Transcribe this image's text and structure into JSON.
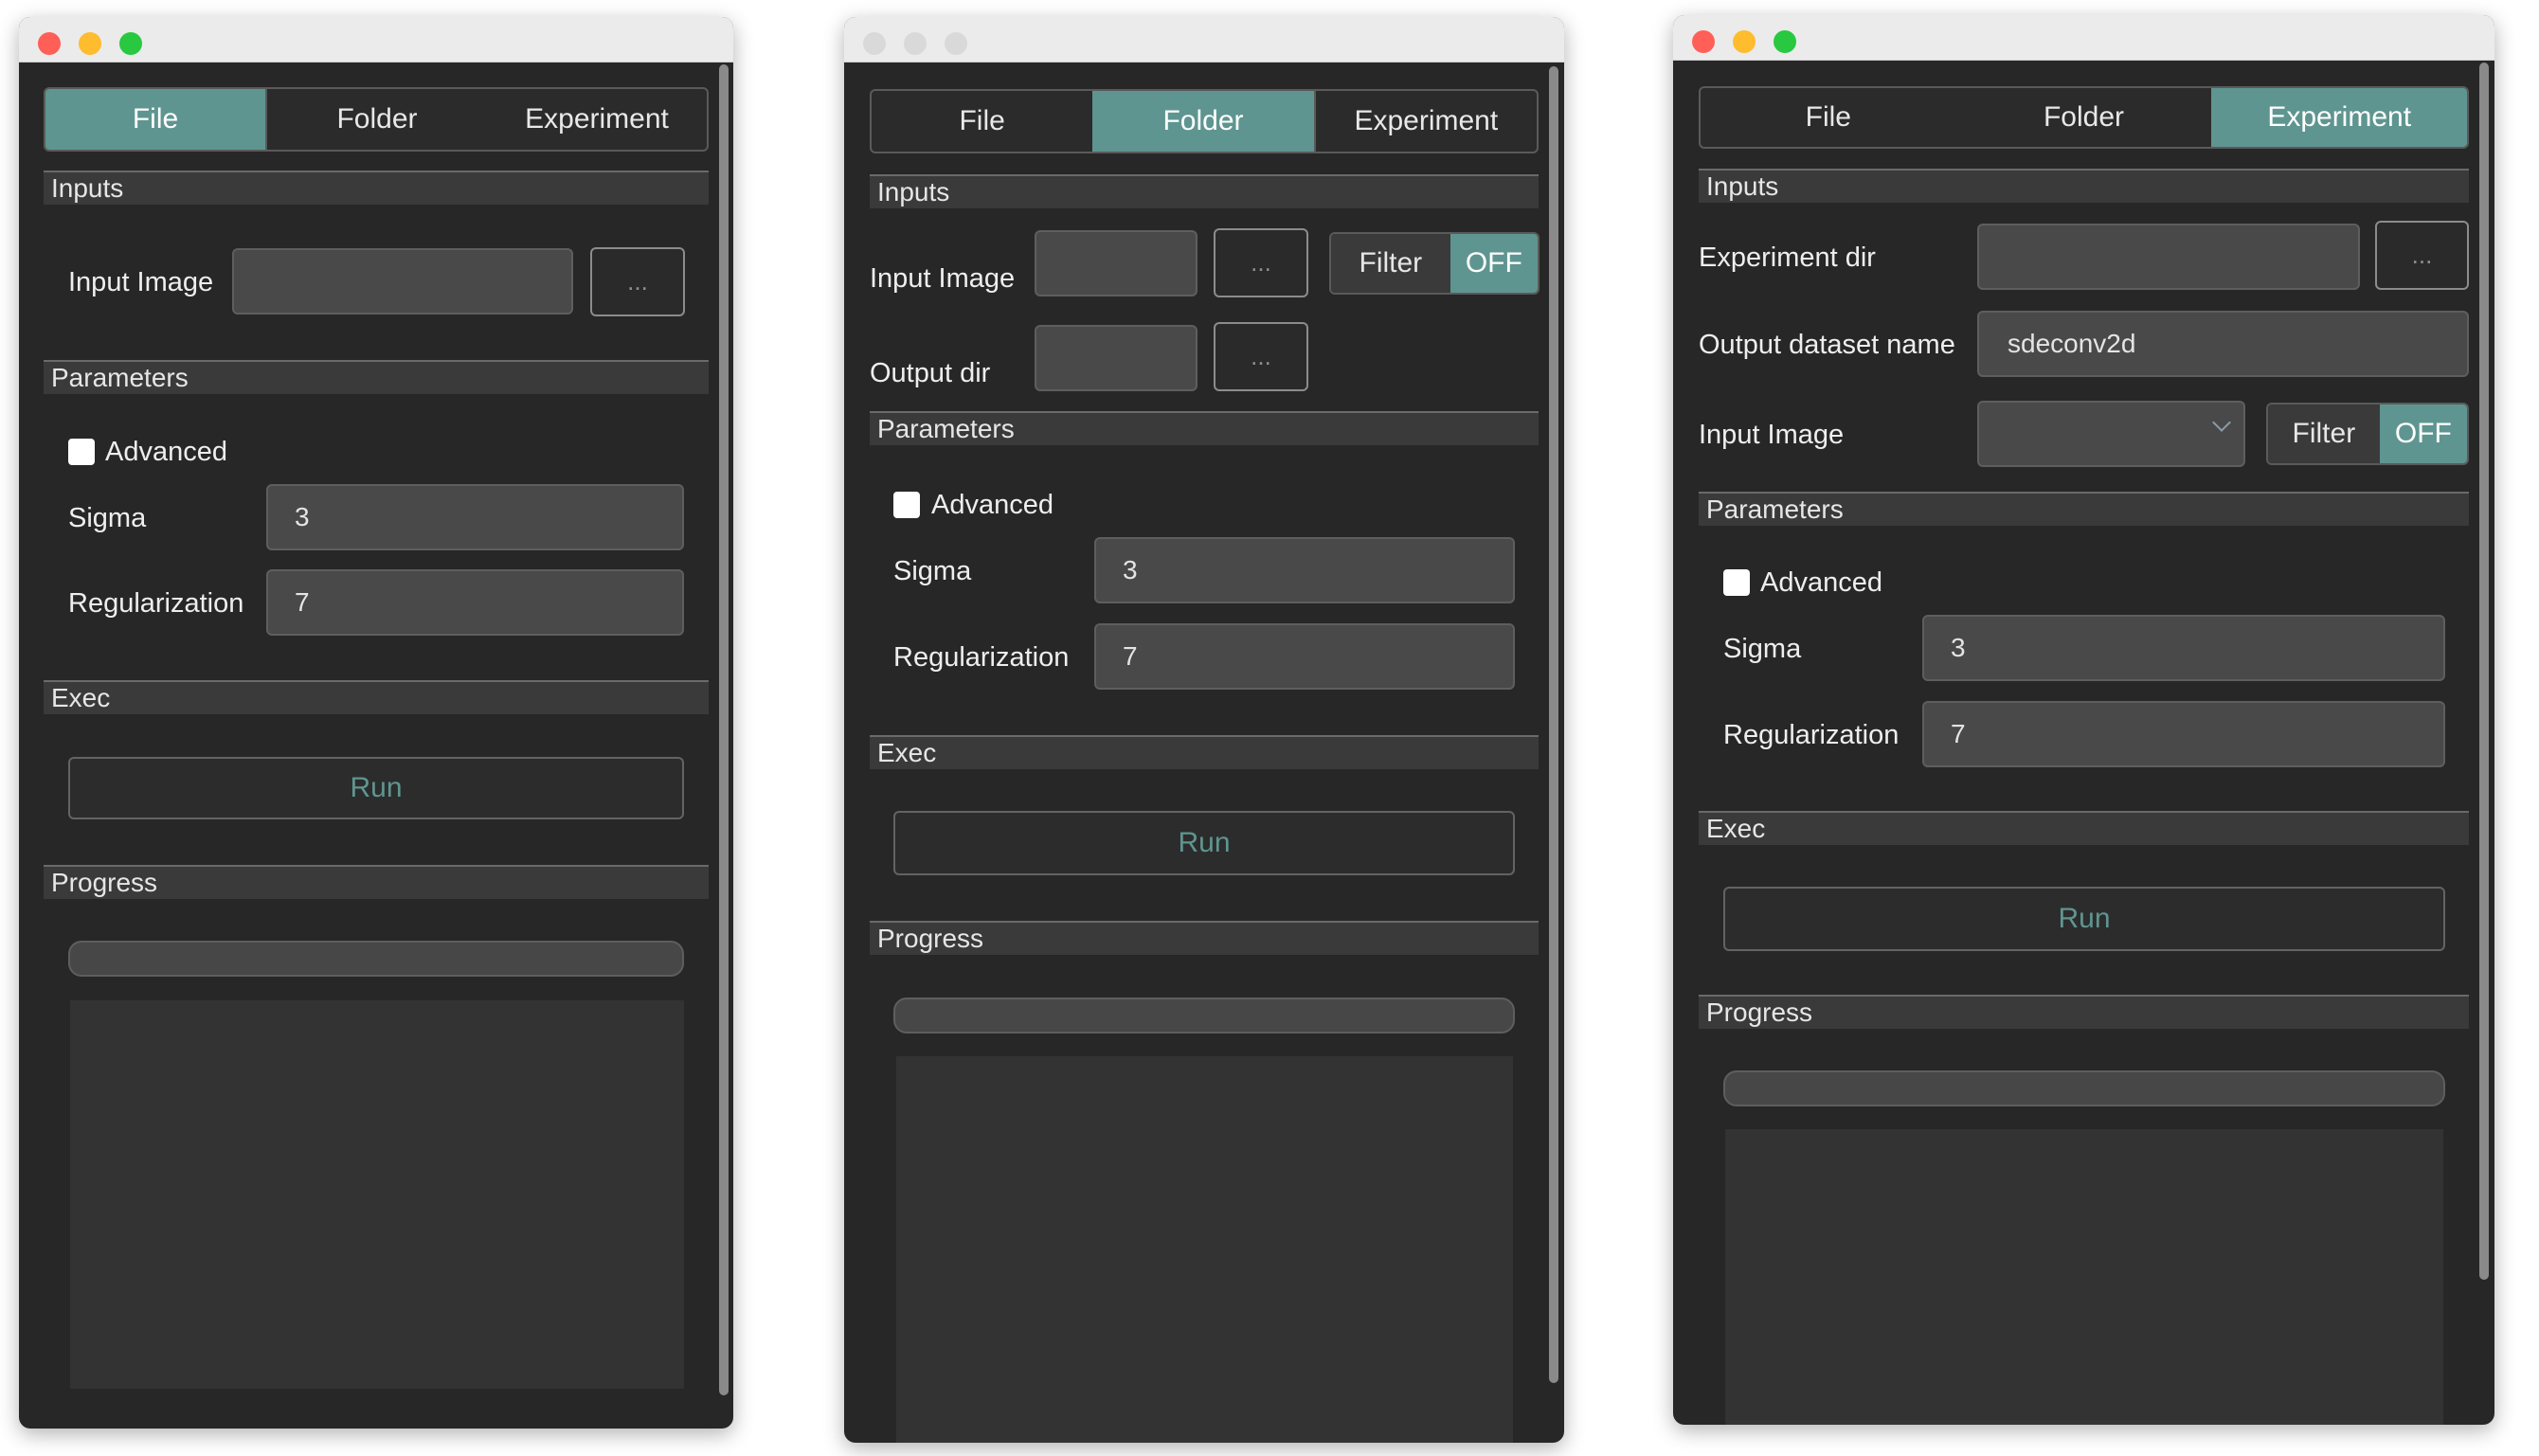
{
  "colors": {
    "accent": "#5f9590",
    "window_bg": "#272727",
    "close": "#ff5f57",
    "minimize": "#febc2e",
    "zoom": "#28c840",
    "inactive_light": "#d9d9d9"
  },
  "tabs": [
    "File",
    "Folder",
    "Experiment"
  ],
  "sections": {
    "inputs": "Inputs",
    "parameters": "Parameters",
    "exec": "Exec",
    "progress": "Progress"
  },
  "labels": {
    "input_image": "Input Image",
    "output_dir": "Output dir",
    "experiment_dir": "Experiment dir",
    "output_dataset_name": "Output dataset name",
    "advanced": "Advanced",
    "sigma": "Sigma",
    "regularization": "Regularization"
  },
  "values": {
    "sigma": "3",
    "regularization": "7",
    "output_dataset_name": "sdeconv2d"
  },
  "buttons": {
    "browse": "...",
    "run": "Run",
    "filter": "Filter",
    "filter_state": "OFF"
  },
  "windows": [
    {
      "active_tab": "File",
      "focused": true,
      "progress": 0
    },
    {
      "active_tab": "Folder",
      "focused": false,
      "progress": 0
    },
    {
      "active_tab": "Experiment",
      "focused": true,
      "progress": 0
    }
  ]
}
